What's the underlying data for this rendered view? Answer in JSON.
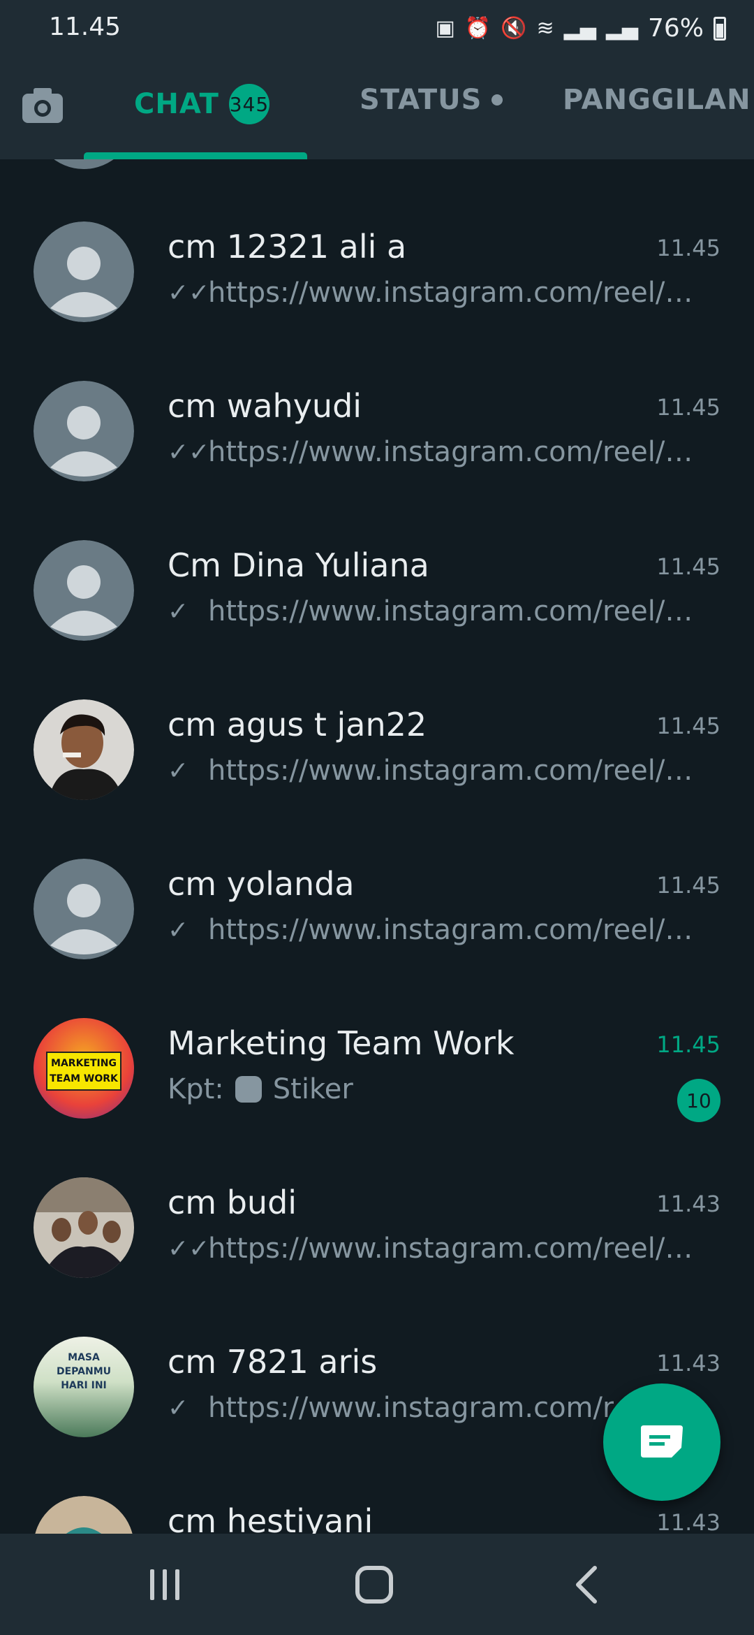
{
  "status_bar": {
    "time": "11.45",
    "battery": "76%"
  },
  "tabs": {
    "chat": {
      "label": "CHAT",
      "badge": "345"
    },
    "status": {
      "label": "STATUS"
    },
    "calls": {
      "label": "PANGGILAN"
    }
  },
  "colors": {
    "accent": "#00a884",
    "background": "#111b21",
    "header": "#1f2c34",
    "muted": "#8696a0"
  },
  "chats": [
    {
      "name": "cm 12321 ali a",
      "time": "11.45",
      "tick": "✓✓",
      "message": "https://www.instagram.com/reel/C...",
      "avatar": "default-avatar"
    },
    {
      "name": "cm wahyudi",
      "time": "11.45",
      "tick": "✓✓",
      "message": "https://www.instagram.com/reel/C...",
      "avatar": "default-avatar"
    },
    {
      "name": "Cm Dina Yuliana",
      "time": "11.45",
      "tick": "✓",
      "message": "https://www.instagram.com/reel/C...",
      "avatar": "default-avatar"
    },
    {
      "name": "cm agus t jan22",
      "time": "11.45",
      "tick": "✓",
      "message": "https://www.instagram.com/reel/C...",
      "avatar": "photo"
    },
    {
      "name": "cm yolanda",
      "time": "11.45",
      "tick": "✓",
      "message": "https://www.instagram.com/reel/C...",
      "avatar": "default-avatar"
    },
    {
      "name": "Marketing Team Work",
      "time": "11.45",
      "sender": "Kpt:",
      "message": "Stiker",
      "unread": "10",
      "avatar": "group-logo",
      "avatar_text": "MARKETING TEAM WORK"
    },
    {
      "name": "cm budi",
      "time": "11.43",
      "tick": "✓✓",
      "message": "https://www.instagram.com/reel/C...",
      "avatar": "photo"
    },
    {
      "name": "cm 7821 aris",
      "time": "11.43",
      "tick": "✓",
      "message": "https://www.instagram.com/r",
      "avatar": "photo",
      "avatar_text": "MASA DEPANMU HARI INI"
    },
    {
      "name": "cm hestiyani",
      "time": "11.43",
      "avatar": "photo"
    }
  ]
}
